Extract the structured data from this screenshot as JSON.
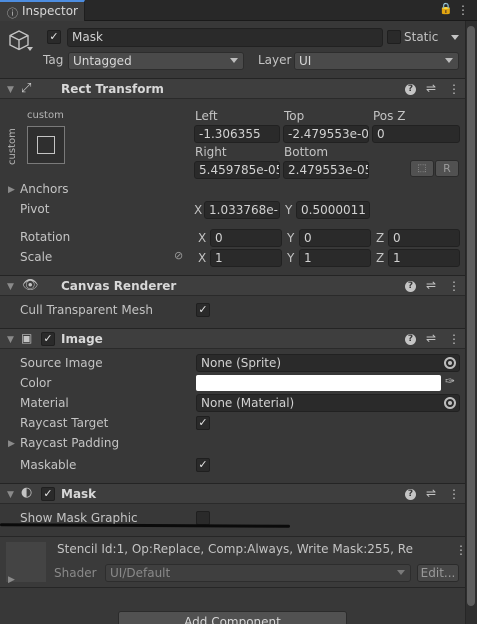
{
  "window": {
    "tab_title": "Inspector"
  },
  "header": {
    "object_name": "Mask",
    "static_label": "Static",
    "tag_label": "Tag",
    "tag_value": "Untagged",
    "layer_label": "Layer",
    "layer_value": "UI"
  },
  "rect_transform": {
    "title": "Rect Transform",
    "anchor_preset_top": "custom",
    "anchor_preset_side": "custom",
    "left_label": "Left",
    "left_value": "-1.306355",
    "top_label": "Top",
    "top_value": "-2.479553e-0",
    "posz_label": "Pos Z",
    "posz_value": "0",
    "right_label": "Right",
    "right_value": "5.459785e-05",
    "bottom_label": "Bottom",
    "bottom_value": "2.479553e-05",
    "raw_button": "R",
    "anchors_label": "Anchors",
    "pivot_label": "Pivot",
    "pivot_x": "1.033768e-(",
    "pivot_y": "0.5000011",
    "rotation_label": "Rotation",
    "rot_x": "0",
    "rot_y": "0",
    "rot_z": "0",
    "scale_label": "Scale",
    "scale_x": "1",
    "scale_y": "1",
    "scale_z": "1",
    "x": "X",
    "y": "Y",
    "z": "Z"
  },
  "canvas_renderer": {
    "title": "Canvas Renderer",
    "cull_label": "Cull Transparent Mesh"
  },
  "image": {
    "title": "Image",
    "source_label": "Source Image",
    "source_value": "None (Sprite)",
    "color_label": "Color",
    "color_value": "#ffffff",
    "material_label": "Material",
    "material_value": "None (Material)",
    "raycast_label": "Raycast Target",
    "padding_label": "Raycast Padding",
    "maskable_label": "Maskable"
  },
  "mask": {
    "title": "Mask",
    "show_graphic_label": "Show Mask Graphic"
  },
  "material_preview": {
    "stencil_text": "Stencil Id:1, Op:Replace, Comp:Always, Write Mask:255, Re",
    "shader_label": "Shader",
    "shader_value": "UI/Default",
    "edit_button": "Edit..."
  },
  "footer": {
    "add_component": "Add Component"
  },
  "colors": {
    "accent": "#4d8de0",
    "background": "#383838"
  }
}
